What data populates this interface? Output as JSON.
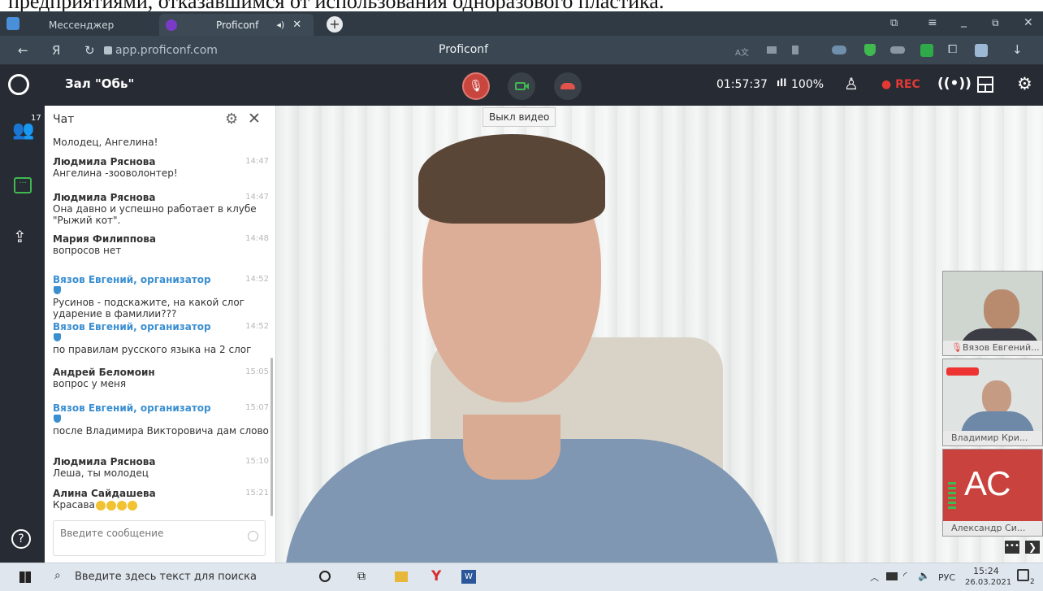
{
  "document_fragment": "предприятиями, отказавшимся от использования одноразового пластика.",
  "browser": {
    "tabs": [
      {
        "label": "Мессенджер"
      },
      {
        "label": "Proficonf"
      }
    ],
    "url": "app.proficonf.com",
    "page_title": "Proficonf",
    "nav_y": "Я"
  },
  "conference": {
    "room": "Зал \"Обь\"",
    "timer": "01:57:37",
    "signal": "100%",
    "rec_label": "REC",
    "tooltip": "Выкл видео",
    "participants_count": "17"
  },
  "chat": {
    "title": "Чат",
    "input_placeholder": "Введите сообщение",
    "messages": [
      {
        "name": "",
        "time": "",
        "text": "Молодец, Ангелина!",
        "org": false
      },
      {
        "name": "Людмила Ряснова",
        "time": "14:47",
        "text": "Ангелина -зооволонтер!",
        "org": false
      },
      {
        "name": "Людмила Ряснова",
        "time": "14:47",
        "text": "Она давно и успешно работает в клубе \"Рыжий кот\".",
        "org": false
      },
      {
        "name": "Мария Филиппова",
        "time": "14:48",
        "text": "вопросов нет",
        "org": false
      },
      {
        "name": "Вязов Евгений, организатор",
        "time": "14:52",
        "text": "Русинов - подскажите, на какой слог ударение в фамилии???",
        "org": true
      },
      {
        "name": "Вязов Евгений, организатор",
        "time": "14:52",
        "text": "по правилам русского языка на 2 слог",
        "org": true
      },
      {
        "name": "Андрей Беломоин",
        "time": "15:05",
        "text": "вопрос у меня",
        "org": false
      },
      {
        "name": "Вязов Евгений, организатор",
        "time": "15:07",
        "text": "после Владимира Викторовича дам слово",
        "org": true
      },
      {
        "name": "Людмила Ряснова",
        "time": "15:10",
        "text": "Леша, ты молодец",
        "org": false
      },
      {
        "name": "Алина Сайдашева",
        "time": "15:21",
        "text": "Красава",
        "org": false
      }
    ]
  },
  "participants": [
    {
      "name": "Вязов Евгений..."
    },
    {
      "name": "Владимир Кри..."
    },
    {
      "name": "Александр Си...",
      "initials": "АС"
    }
  ],
  "taskbar": {
    "search_placeholder": "Введите здесь текст для поиска",
    "lang": "РУС",
    "time": "15:24",
    "date": "26.03.2021",
    "notif": "2"
  },
  "colors": {
    "app_dark": "#272b33",
    "accent_green": "#3fb950",
    "end_call": "#e0524b",
    "org_blue": "#3a8fd1",
    "rec_red": "#e53935"
  }
}
